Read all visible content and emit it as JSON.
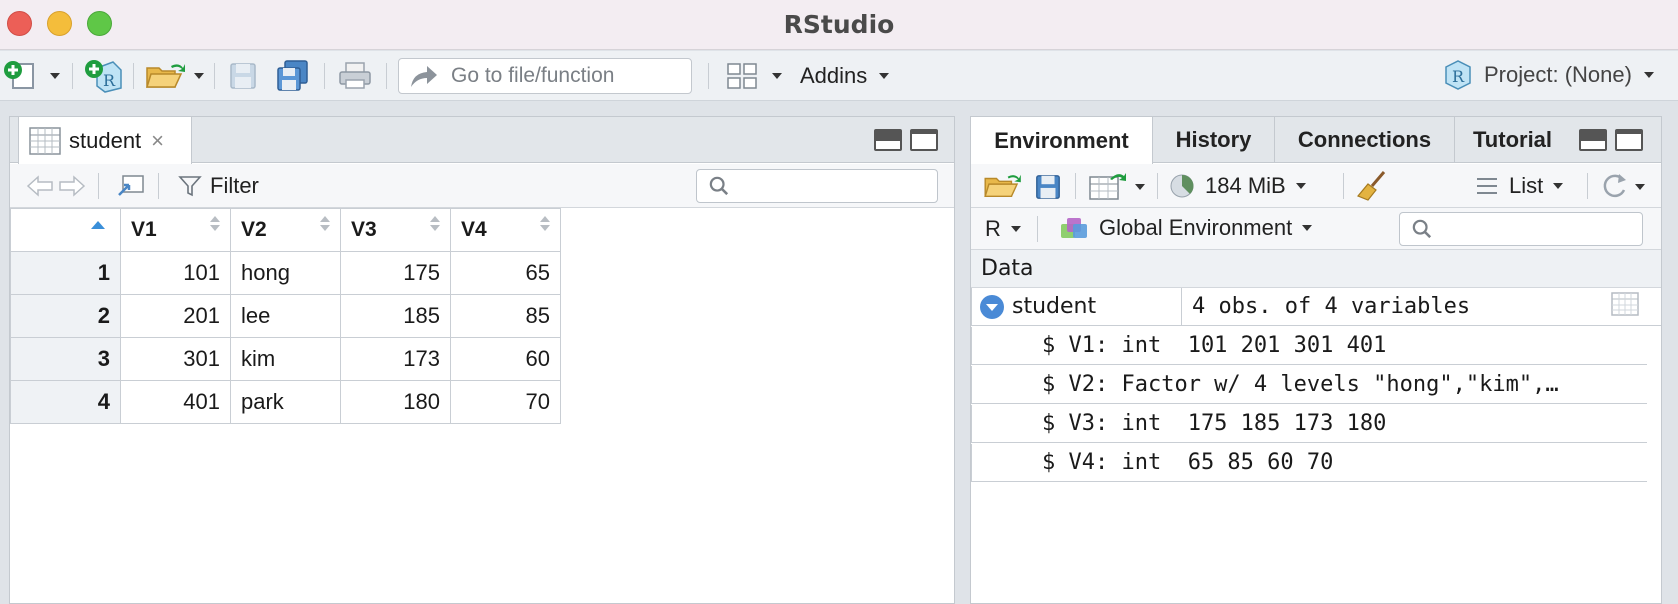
{
  "window": {
    "title": "RStudio"
  },
  "toolbar": {
    "goto_placeholder": "Go to file/function",
    "addins_label": "Addins",
    "project_label": "Project: (None)"
  },
  "data_viewer": {
    "tab_label": "student",
    "tab_close": "×",
    "filter_label": "Filter",
    "columns": [
      "V1",
      "V2",
      "V3",
      "V4"
    ],
    "rows": [
      {
        "n": "1",
        "V1": "101",
        "V2": "hong",
        "V3": "175",
        "V4": "65"
      },
      {
        "n": "2",
        "V1": "201",
        "V2": "lee",
        "V3": "185",
        "V4": "85"
      },
      {
        "n": "3",
        "V1": "301",
        "V2": "kim",
        "V3": "173",
        "V4": "60"
      },
      {
        "n": "4",
        "V1": "401",
        "V2": "park",
        "V3": "180",
        "V4": "70"
      }
    ]
  },
  "env_pane": {
    "tabs": [
      "Environment",
      "History",
      "Connections",
      "Tutorial"
    ],
    "memory_label": "184 MiB",
    "view_mode": "List",
    "language": "R",
    "scope": "Global Environment",
    "section_header": "Data",
    "object": {
      "name": "student",
      "summary": "4 obs. of 4 variables"
    },
    "structure_lines": [
      "$ V1: int  101 201 301 401",
      "$ V2: Factor w/ 4 levels \"hong\",\"kim\",…",
      "$ V3: int  175 185 173 180",
      "$ V4: int  65 85 60 70"
    ]
  }
}
